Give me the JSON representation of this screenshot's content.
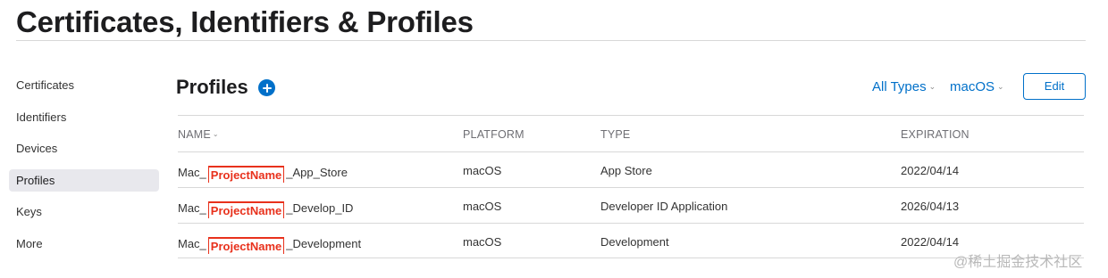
{
  "header": {
    "title": "Certificates, Identifiers & Profiles"
  },
  "sidebar": {
    "items": [
      {
        "label": "Certificates",
        "active": false
      },
      {
        "label": "Identifiers",
        "active": false
      },
      {
        "label": "Devices",
        "active": false
      },
      {
        "label": "Profiles",
        "active": true
      },
      {
        "label": "Keys",
        "active": false
      },
      {
        "label": "More",
        "active": false
      }
    ]
  },
  "main": {
    "section_title": "Profiles",
    "filters": {
      "types": "All Types",
      "platform": "macOS"
    },
    "edit_label": "Edit",
    "table": {
      "columns": [
        "NAME",
        "PLATFORM",
        "TYPE",
        "EXPIRATION"
      ],
      "rows": [
        {
          "name_prefix": "Mac_",
          "name_redacted": "ProjectName",
          "name_suffix": "_App_Store",
          "platform": "macOS",
          "type": "App Store",
          "expiration": "2022/04/14"
        },
        {
          "name_prefix": "Mac_",
          "name_redacted": "ProjectName",
          "name_suffix": "_Develop_ID",
          "platform": "macOS",
          "type": "Developer ID Application",
          "expiration": "2026/04/13"
        },
        {
          "name_prefix": "Mac_",
          "name_redacted": "ProjectName",
          "name_suffix": "_Development",
          "platform": "macOS",
          "type": "Development",
          "expiration": "2022/04/14"
        }
      ]
    }
  },
  "watermark": "@稀土掘金技术社区",
  "colors": {
    "accent": "#0070c9",
    "redaction": "#e8311c",
    "active_bg": "#e8e8ed"
  },
  "icons": {
    "add": "plus-circle-icon",
    "sort": "chevron-down-icon"
  }
}
